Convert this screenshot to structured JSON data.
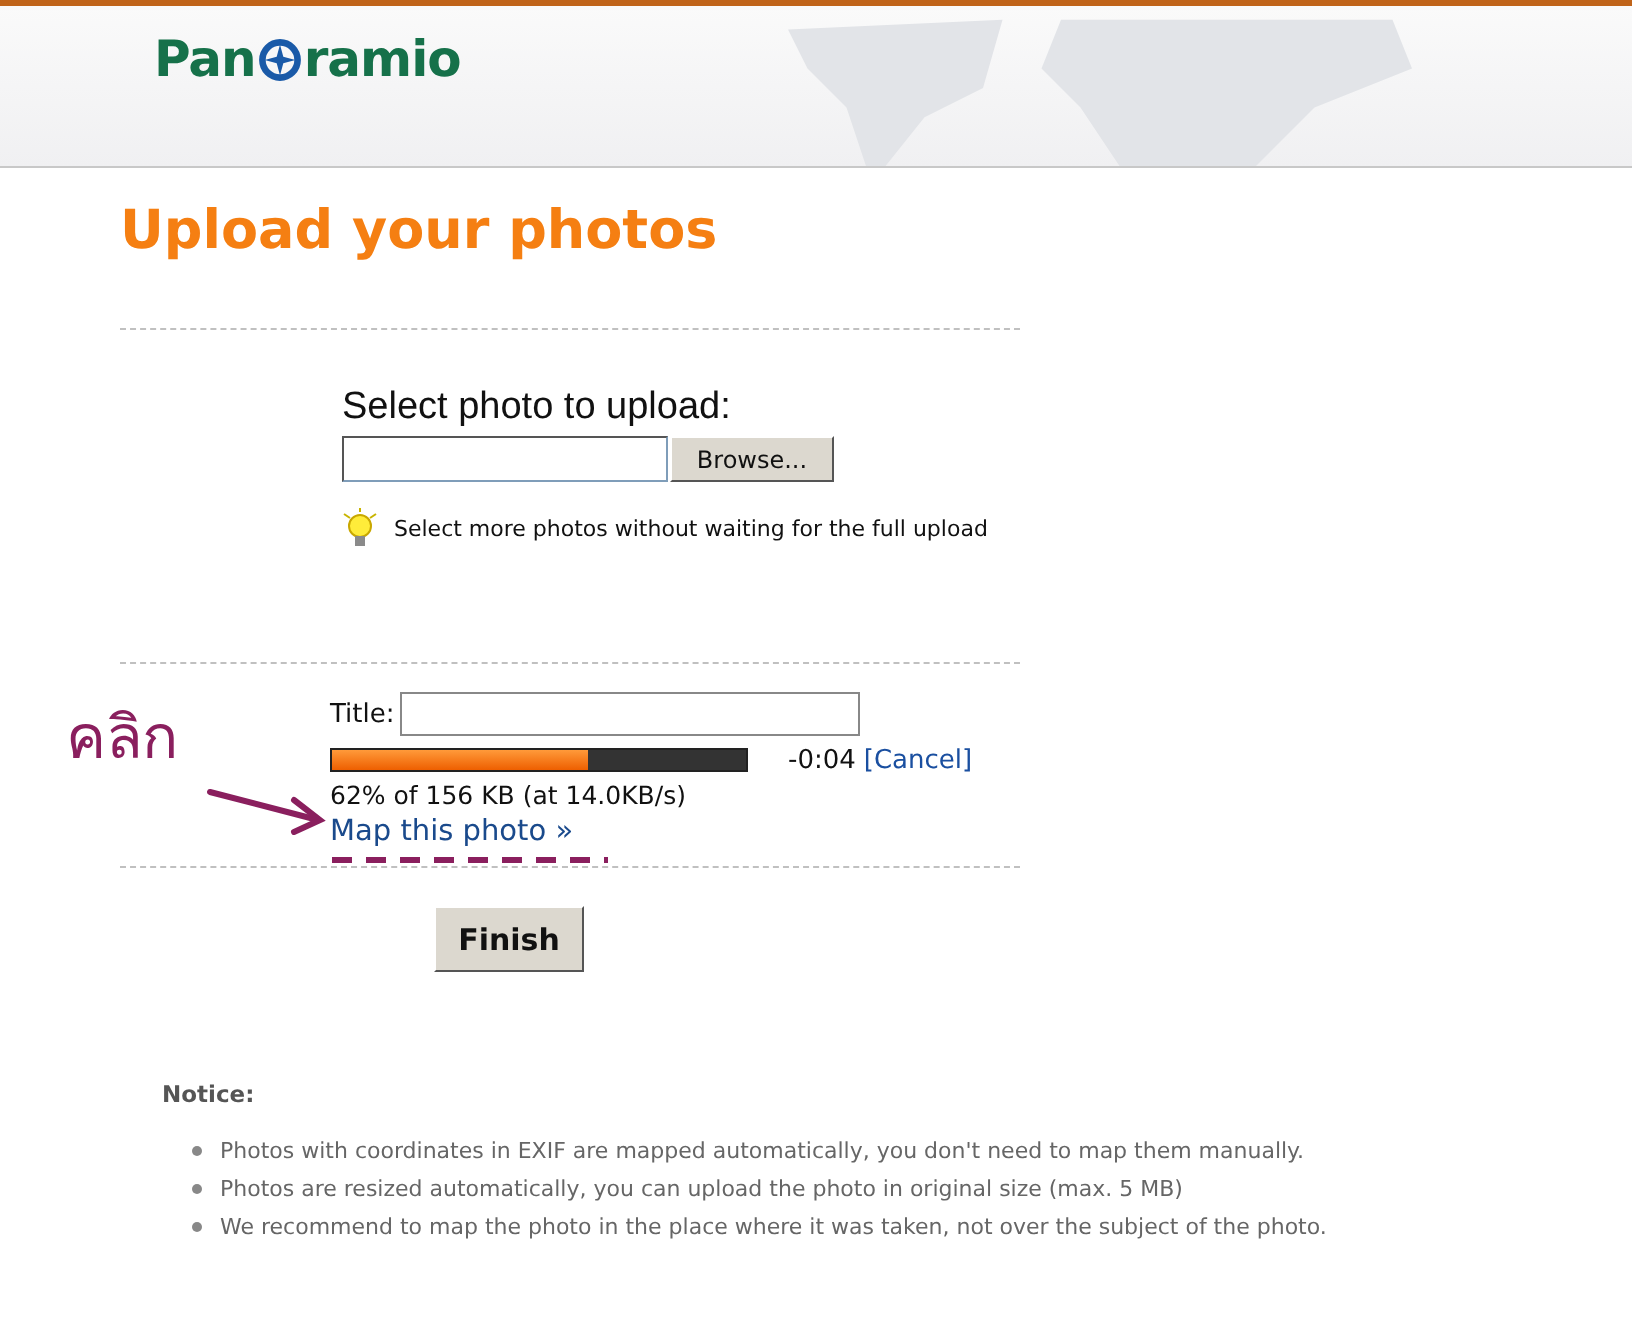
{
  "header": {
    "logo": {
      "before": "Pan",
      "after": "ramio"
    }
  },
  "page_title": "Upload your photos",
  "select": {
    "heading": "Select photo to upload:",
    "browse_button": "Browse...",
    "hint": "Select more photos without waiting for the full upload"
  },
  "upload": {
    "title_label": "Title:",
    "progress": {
      "level": 0.62
    },
    "time_left": "-0:04",
    "cancel_link": "[Cancel]",
    "status": "62% of 156 KB (at 14.0KB/s)",
    "map_link": "Map this photo »"
  },
  "finish_button": "Finish",
  "notice": {
    "heading": "Notice:",
    "items": [
      "Photos with coordinates in EXIF are mapped automatically, you don't need to map them manually.",
      "Photos are resized automatically, you can upload the photo in original size (max. 5 MB)",
      "We recommend to map the photo in the place where it was taken, not over the subject of the photo."
    ]
  },
  "annotation": {
    "text": "คลิก"
  }
}
